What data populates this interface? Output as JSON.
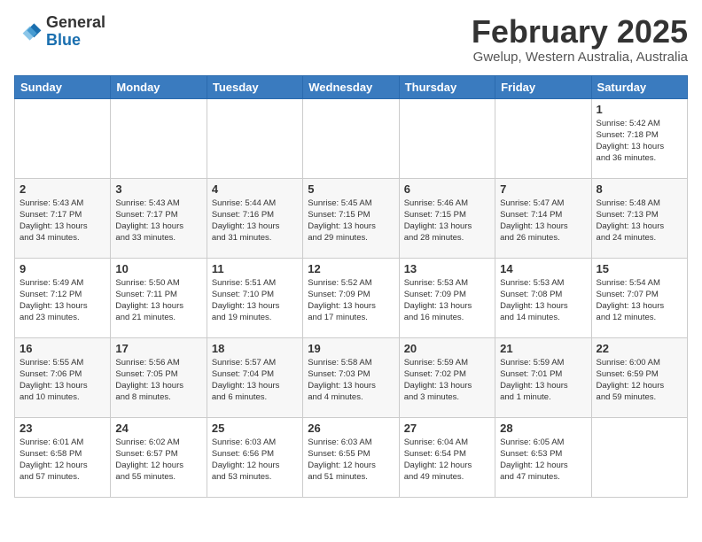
{
  "header": {
    "logo_general": "General",
    "logo_blue": "Blue",
    "month_year": "February 2025",
    "location": "Gwelup, Western Australia, Australia"
  },
  "calendar": {
    "days_of_week": [
      "Sunday",
      "Monday",
      "Tuesday",
      "Wednesday",
      "Thursday",
      "Friday",
      "Saturday"
    ],
    "weeks": [
      [
        {
          "day": "",
          "info": ""
        },
        {
          "day": "",
          "info": ""
        },
        {
          "day": "",
          "info": ""
        },
        {
          "day": "",
          "info": ""
        },
        {
          "day": "",
          "info": ""
        },
        {
          "day": "",
          "info": ""
        },
        {
          "day": "1",
          "info": "Sunrise: 5:42 AM\nSunset: 7:18 PM\nDaylight: 13 hours\nand 36 minutes."
        }
      ],
      [
        {
          "day": "2",
          "info": "Sunrise: 5:43 AM\nSunset: 7:17 PM\nDaylight: 13 hours\nand 34 minutes."
        },
        {
          "day": "3",
          "info": "Sunrise: 5:43 AM\nSunset: 7:17 PM\nDaylight: 13 hours\nand 33 minutes."
        },
        {
          "day": "4",
          "info": "Sunrise: 5:44 AM\nSunset: 7:16 PM\nDaylight: 13 hours\nand 31 minutes."
        },
        {
          "day": "5",
          "info": "Sunrise: 5:45 AM\nSunset: 7:15 PM\nDaylight: 13 hours\nand 29 minutes."
        },
        {
          "day": "6",
          "info": "Sunrise: 5:46 AM\nSunset: 7:15 PM\nDaylight: 13 hours\nand 28 minutes."
        },
        {
          "day": "7",
          "info": "Sunrise: 5:47 AM\nSunset: 7:14 PM\nDaylight: 13 hours\nand 26 minutes."
        },
        {
          "day": "8",
          "info": "Sunrise: 5:48 AM\nSunset: 7:13 PM\nDaylight: 13 hours\nand 24 minutes."
        }
      ],
      [
        {
          "day": "9",
          "info": "Sunrise: 5:49 AM\nSunset: 7:12 PM\nDaylight: 13 hours\nand 23 minutes."
        },
        {
          "day": "10",
          "info": "Sunrise: 5:50 AM\nSunset: 7:11 PM\nDaylight: 13 hours\nand 21 minutes."
        },
        {
          "day": "11",
          "info": "Sunrise: 5:51 AM\nSunset: 7:10 PM\nDaylight: 13 hours\nand 19 minutes."
        },
        {
          "day": "12",
          "info": "Sunrise: 5:52 AM\nSunset: 7:09 PM\nDaylight: 13 hours\nand 17 minutes."
        },
        {
          "day": "13",
          "info": "Sunrise: 5:53 AM\nSunset: 7:09 PM\nDaylight: 13 hours\nand 16 minutes."
        },
        {
          "day": "14",
          "info": "Sunrise: 5:53 AM\nSunset: 7:08 PM\nDaylight: 13 hours\nand 14 minutes."
        },
        {
          "day": "15",
          "info": "Sunrise: 5:54 AM\nSunset: 7:07 PM\nDaylight: 13 hours\nand 12 minutes."
        }
      ],
      [
        {
          "day": "16",
          "info": "Sunrise: 5:55 AM\nSunset: 7:06 PM\nDaylight: 13 hours\nand 10 minutes."
        },
        {
          "day": "17",
          "info": "Sunrise: 5:56 AM\nSunset: 7:05 PM\nDaylight: 13 hours\nand 8 minutes."
        },
        {
          "day": "18",
          "info": "Sunrise: 5:57 AM\nSunset: 7:04 PM\nDaylight: 13 hours\nand 6 minutes."
        },
        {
          "day": "19",
          "info": "Sunrise: 5:58 AM\nSunset: 7:03 PM\nDaylight: 13 hours\nand 4 minutes."
        },
        {
          "day": "20",
          "info": "Sunrise: 5:59 AM\nSunset: 7:02 PM\nDaylight: 13 hours\nand 3 minutes."
        },
        {
          "day": "21",
          "info": "Sunrise: 5:59 AM\nSunset: 7:01 PM\nDaylight: 13 hours\nand 1 minute."
        },
        {
          "day": "22",
          "info": "Sunrise: 6:00 AM\nSunset: 6:59 PM\nDaylight: 12 hours\nand 59 minutes."
        }
      ],
      [
        {
          "day": "23",
          "info": "Sunrise: 6:01 AM\nSunset: 6:58 PM\nDaylight: 12 hours\nand 57 minutes."
        },
        {
          "day": "24",
          "info": "Sunrise: 6:02 AM\nSunset: 6:57 PM\nDaylight: 12 hours\nand 55 minutes."
        },
        {
          "day": "25",
          "info": "Sunrise: 6:03 AM\nSunset: 6:56 PM\nDaylight: 12 hours\nand 53 minutes."
        },
        {
          "day": "26",
          "info": "Sunrise: 6:03 AM\nSunset: 6:55 PM\nDaylight: 12 hours\nand 51 minutes."
        },
        {
          "day": "27",
          "info": "Sunrise: 6:04 AM\nSunset: 6:54 PM\nDaylight: 12 hours\nand 49 minutes."
        },
        {
          "day": "28",
          "info": "Sunrise: 6:05 AM\nSunset: 6:53 PM\nDaylight: 12 hours\nand 47 minutes."
        },
        {
          "day": "",
          "info": ""
        }
      ]
    ]
  }
}
